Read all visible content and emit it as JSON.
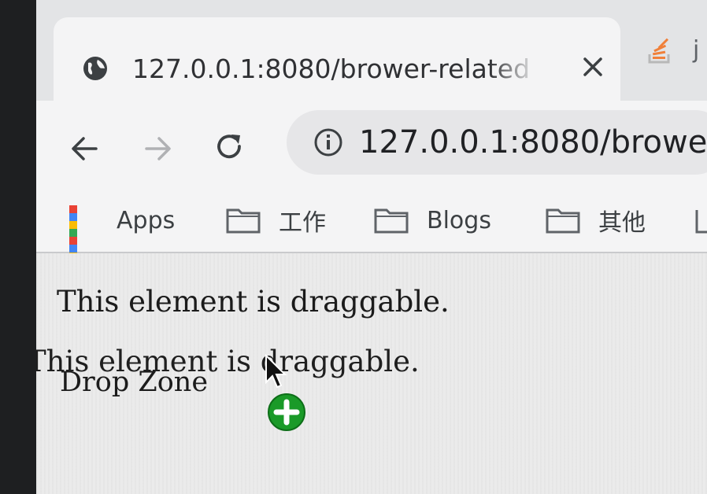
{
  "browser": {
    "tab": {
      "title": "127.0.0.1:8080/brower-related",
      "icon": "globe-icon",
      "close_icon": "close-icon"
    },
    "tab2": {
      "icon": "stack-overflow-icon",
      "title_fragment": "j"
    },
    "toolbar": {
      "back_icon": "back-arrow-icon",
      "forward_icon": "forward-arrow-icon",
      "reload_icon": "reload-icon",
      "info_icon": "info-icon",
      "url": "127.0.0.1:8080/browe"
    },
    "bookmarks": [
      {
        "label": "Apps",
        "icon": "apps-grid-icon"
      },
      {
        "label": "工作",
        "icon": "folder-icon"
      },
      {
        "label": "Blogs",
        "icon": "folder-icon"
      },
      {
        "label": "其他",
        "icon": "folder-icon"
      }
    ]
  },
  "page": {
    "draggable_text": "This element is draggable.",
    "drop_zone_text": "Drop Zone",
    "drag_ghost_text": "This element is draggable."
  },
  "colors": {
    "copy_badge": "#1a9a28",
    "page_text": "#1b1b1b"
  }
}
